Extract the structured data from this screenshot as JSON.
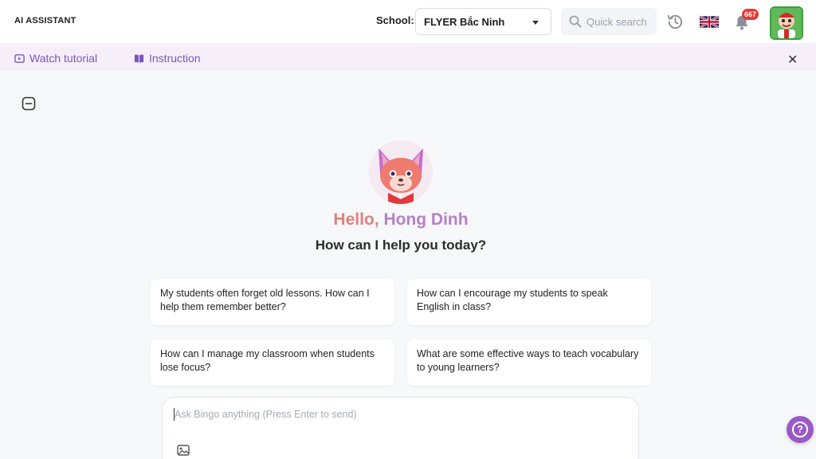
{
  "header": {
    "app_title": "AI ASSISTANT",
    "school_label": "School:",
    "school_value": "FLYER Bắc Ninh",
    "search_placeholder": "Quick search",
    "notification_count": "667",
    "language_flag": "uk-flag-icon"
  },
  "tutorial_bar": {
    "watch_label": "Watch tutorial",
    "instruction_label": "Instruction"
  },
  "greeting": {
    "hello": "Hello,",
    "name": "Hong Dinh",
    "subtitle": "How can I help you today?"
  },
  "suggestions": [
    "My students often forget old lessons. How can I help them remember better?",
    "How can I encourage my students to speak English in class?",
    "How can I manage my classroom when students lose focus?",
    "What are some effective ways to teach vocabulary to young learners?"
  ],
  "chat": {
    "placeholder": "Ask Bingo anything (Press Enter to send)"
  },
  "help": {
    "label": "?"
  },
  "colors": {
    "accent_purple": "#7b55b9",
    "banner_bg": "#f6effa",
    "greeting_start": "#e2807e",
    "greeting_end": "#b77fc6",
    "help_button": "#9b59c6"
  }
}
